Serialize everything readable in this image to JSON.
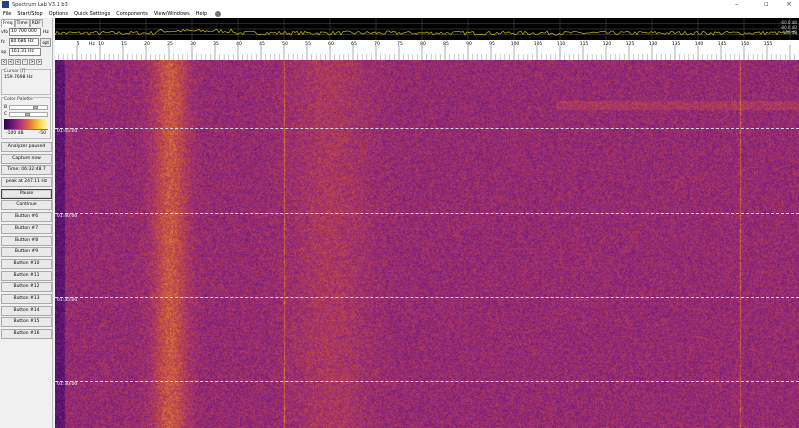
{
  "window": {
    "title": "Spectrum Lab V3.1 b3"
  },
  "menu": [
    "File",
    "Start/Stop",
    "Options",
    "Quick Settings",
    "Components",
    "View/Windows",
    "Help"
  ],
  "tabs": [
    "Freq",
    "Time",
    "RDF"
  ],
  "vfo": {
    "label": "vfo",
    "value": "10 700 000",
    "unit": "Hz"
  },
  "fc": {
    "label": "fc",
    "value": "80.686 Hz",
    "button": "opt"
  },
  "sp": {
    "label": "sp",
    "value": "161.31 Hz"
  },
  "small_buttons": [
    "<",
    "<",
    "<",
    "-",
    ">",
    ">"
  ],
  "cursor": {
    "title": "Cursor [f]",
    "value": "159.7698 Hz"
  },
  "palette": {
    "title": "Color Palette",
    "b_label": "B",
    "c_label": "C",
    "b_level": 0.75,
    "c_level": 0.5,
    "min": "-100 dB",
    "max": "-50"
  },
  "buttons": [
    "Analyzer paused",
    "Capture now",
    "Time:  06:32:48.7",
    "peak at 247.11 Hz",
    "Pause",
    "Continue",
    "Button #6",
    "Button #7",
    "Button #8",
    "Button #9",
    "Button #10",
    "Button #11",
    "Button #12",
    "Button #13",
    "Button #14",
    "Button #15",
    "Button #16"
  ],
  "spectrum": {
    "db_labels": [
      "-60.0 dB",
      "-80.0 dB",
      "-100 dB"
    ],
    "trace_color": "#c8c000"
  },
  "axis": {
    "unit": "Hz",
    "ticks": [
      5,
      10,
      15,
      20,
      25,
      30,
      35,
      40,
      45,
      50,
      55,
      60,
      65,
      70,
      75,
      80,
      85,
      90,
      95,
      100,
      105,
      110,
      115,
      120,
      125,
      130,
      135,
      140,
      145,
      150,
      155
    ]
  },
  "waterfall": {
    "time_labels": [
      "01:45:00",
      "01:40:00",
      "01:35:00",
      "01:30:00"
    ]
  }
}
